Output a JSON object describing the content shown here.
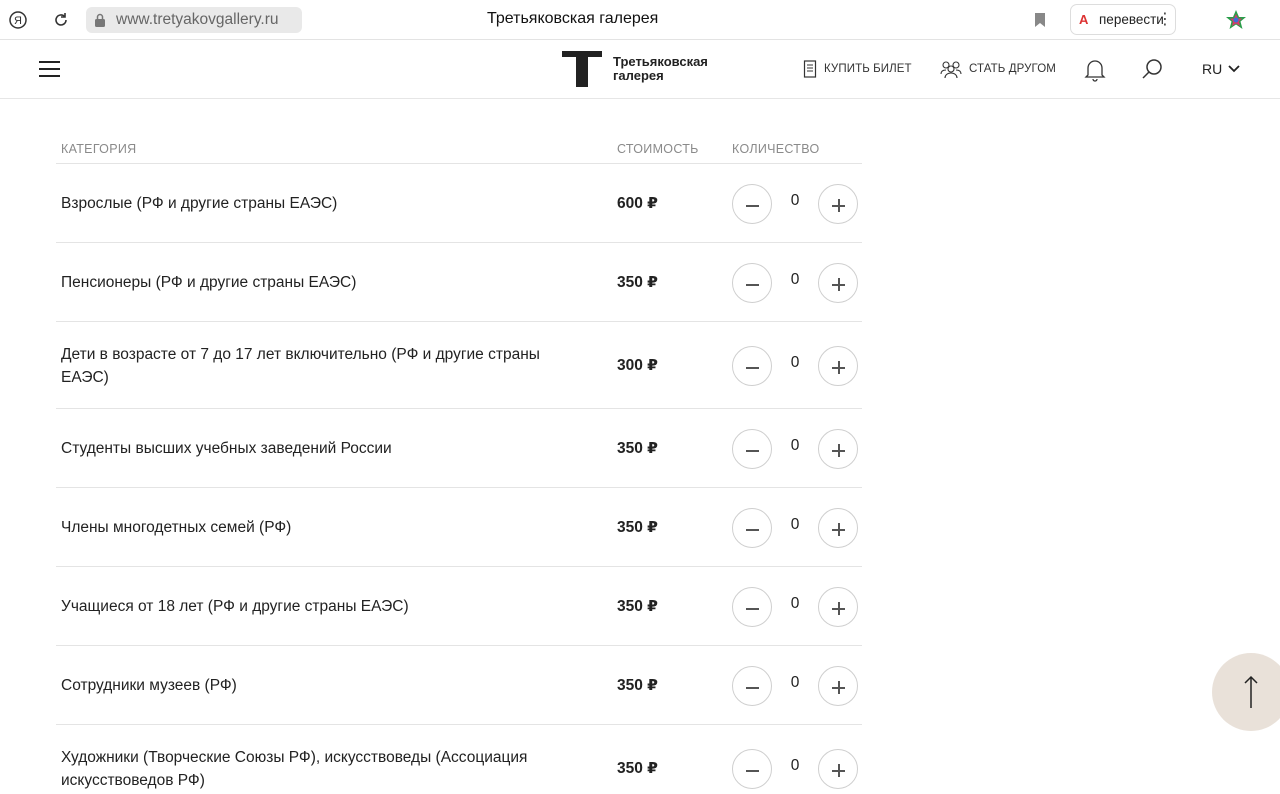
{
  "browser": {
    "url": "www.tretyakovgallery.ru",
    "tab_title": "Третьяковская галерея",
    "translate_label": "перевести"
  },
  "header": {
    "logo_line1": "Третьяковская",
    "logo_line2": "галерея",
    "buy_ticket": "КУПИТЬ БИЛЕТ",
    "become_friend": "СТАТЬ ДРУГОМ",
    "language": "RU"
  },
  "table": {
    "columns": {
      "category": "КАТЕГОРИЯ",
      "price": "СТОИМОСТЬ",
      "quantity": "КОЛИЧЕСТВО"
    },
    "rows": [
      {
        "category": "Взрослые (РФ и другие страны ЕАЭС)",
        "price": "600 ₽",
        "quantity": "0"
      },
      {
        "category": "Пенсионеры (РФ и другие страны ЕАЭС)",
        "price": "350 ₽",
        "quantity": "0"
      },
      {
        "category": "Дети в возрасте от 7 до 17 лет включительно (РФ и другие страны ЕАЭС)",
        "price": "300 ₽",
        "quantity": "0"
      },
      {
        "category": "Студенты высших учебных заведений России",
        "price": "350 ₽",
        "quantity": "0"
      },
      {
        "category": "Члены многодетных семей (РФ)",
        "price": "350 ₽",
        "quantity": "0"
      },
      {
        "category": "Учащиеся от 18 лет (РФ и другие страны ЕАЭС)",
        "price": "350 ₽",
        "quantity": "0"
      },
      {
        "category": "Сотрудники музеев (РФ)",
        "price": "350 ₽",
        "quantity": "0"
      },
      {
        "category": "Художники (Творческие Союзы РФ), искусствоведы (Ассоциация искусствоведов РФ)",
        "price": "350 ₽",
        "quantity": "0"
      }
    ]
  },
  "colors": {
    "scroll_top_bg": "#e9e1d9",
    "divider": "#e4e4e4",
    "muted_header": "#8a8a8a"
  }
}
